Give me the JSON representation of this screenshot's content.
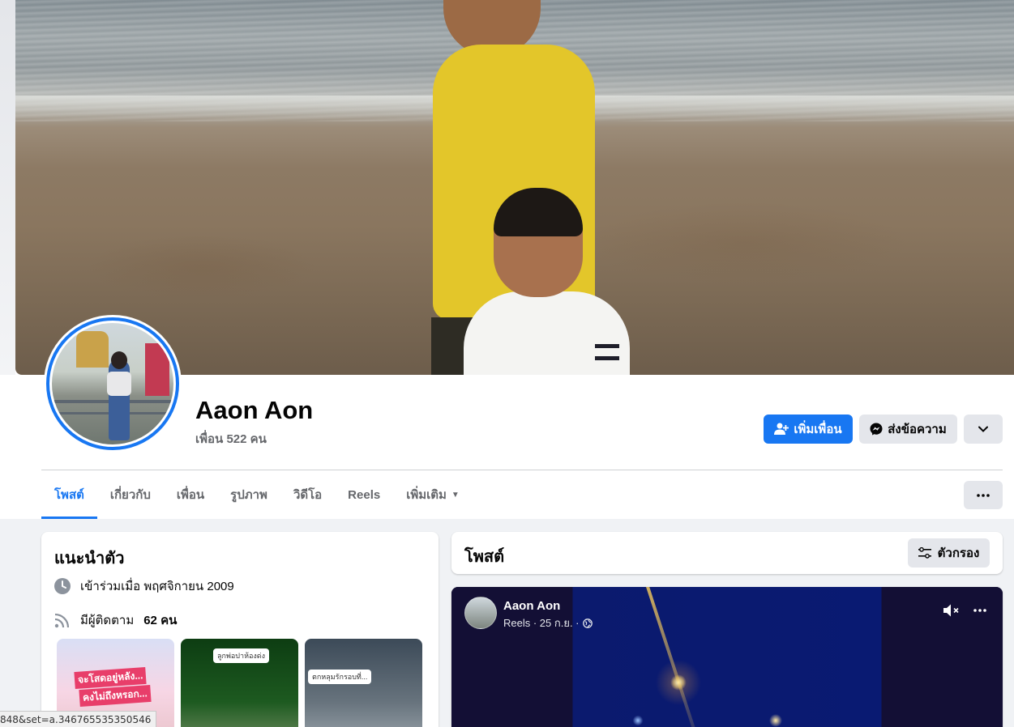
{
  "profile": {
    "name": "Aaon Aon",
    "friends_text": "เพื่อน 522 คน"
  },
  "actions": {
    "add_friend_label": "เพิ่มเพื่อน",
    "message_label": "ส่งข้อความ"
  },
  "tabs": [
    {
      "label": "โพสต์",
      "active": true
    },
    {
      "label": "เกี่ยวกับ",
      "active": false
    },
    {
      "label": "เพื่อน",
      "active": false
    },
    {
      "label": "รูปภาพ",
      "active": false
    },
    {
      "label": "วิดีโอ",
      "active": false
    },
    {
      "label": "Reels",
      "active": false
    },
    {
      "label": "เพิ่มเติม",
      "active": false
    }
  ],
  "intro": {
    "title": "แนะนำตัว",
    "joined_text": "เข้าร่วมเมื่อ พฤศจิกายน 2009",
    "followers_prefix": "มีผู้ติดตาม",
    "followers_value": "62 คน",
    "featured": [
      {
        "caption1": "จะโสดอยู่หลัง...",
        "caption2": "คงไม่ถึงหรอก..."
      },
      {
        "tag": "ลูกพ่อ​ปาห้องด่ง"
      },
      {
        "tag": "ตกหลุมรักรอบที่..."
      }
    ]
  },
  "posts": {
    "title": "โพสต์",
    "filter_label": "ตัวกรอง"
  },
  "reel_post": {
    "author": "Aaon Aon",
    "meta": "Reels · 25 ก.ย. ·"
  },
  "status_bar": {
    "url_fragment": "848&set=a.346765535350546"
  },
  "colors": {
    "accent": "#1877f2",
    "secondary_button": "#e4e6eb",
    "page_bg": "#f0f2f5"
  }
}
